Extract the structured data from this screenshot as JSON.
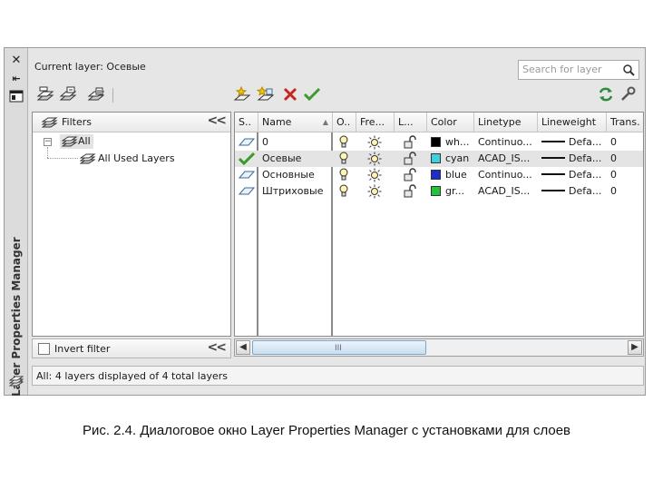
{
  "window": {
    "vertical_title": "Layer Properties Manager",
    "current_layer": "Current layer: Осевые"
  },
  "search": {
    "placeholder": "Search for layer"
  },
  "filters_panel": {
    "header": "Filters",
    "tree": [
      {
        "label": "All",
        "level": 0,
        "selected": true
      },
      {
        "label": "All Used Layers",
        "level": 1,
        "selected": false
      }
    ],
    "invert_filter_label": "Invert filter",
    "invert_filter_checked": false
  },
  "grid": {
    "columns": [
      "S..",
      "Name",
      "O..",
      "Fre...",
      "L...",
      "Color",
      "Linetype",
      "Lineweight",
      "Trans."
    ],
    "rows": [
      {
        "status": "layer-icon",
        "name": "0",
        "on": true,
        "freeze": false,
        "lock": false,
        "color_name": "wh...",
        "color_hex": "#000000",
        "linetype": "Continuo...",
        "lineweight": "Defa...",
        "transparency": "0",
        "selected": false
      },
      {
        "status": "current-check-icon",
        "name": "Осевые",
        "on": true,
        "freeze": false,
        "lock": false,
        "color_name": "cyan",
        "color_hex": "#3fd0de",
        "linetype": "ACAD_IS...",
        "lineweight": "Defa...",
        "transparency": "0",
        "selected": true
      },
      {
        "status": "layer-icon",
        "name": "Основные",
        "on": true,
        "freeze": false,
        "lock": false,
        "color_name": "blue",
        "color_hex": "#1c2fc8",
        "linetype": "Continuo...",
        "lineweight": "Defa...",
        "transparency": "0",
        "selected": false
      },
      {
        "status": "layer-icon",
        "name": "Штриховые",
        "on": true,
        "freeze": false,
        "lock": false,
        "color_name": "gr...",
        "color_hex": "#22c33a",
        "linetype": "ACAD_IS...",
        "lineweight": "Defa...",
        "transparency": "0",
        "selected": false
      }
    ]
  },
  "scrollbar": {
    "grip": "III"
  },
  "status_bar": "All: 4 layers displayed of 4 total layers",
  "caption": "Рис. 2.4. Диалоговое окно Layer Properties Manager с установками для слоев",
  "colors": {
    "dialog_bg": "#e6e6e6",
    "selection": "#e4e4e4",
    "delete_red": "#c8261b",
    "check_green": "#3a9a2a"
  }
}
